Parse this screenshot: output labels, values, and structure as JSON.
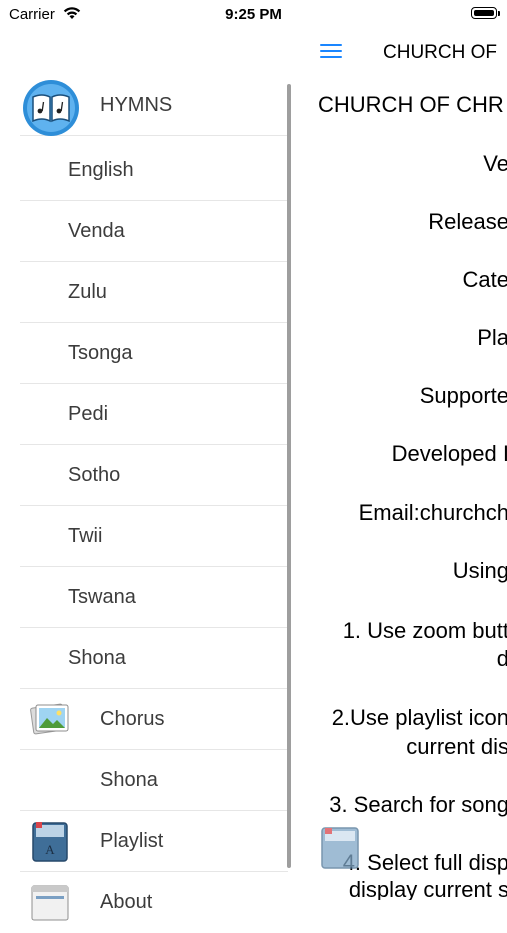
{
  "status": {
    "carrier": "Carrier",
    "time": "9:25 PM"
  },
  "navbar": {
    "title": "CHURCH OF"
  },
  "content": {
    "lines": [
      "CHURCH OF CHR",
      "Ve",
      "Release",
      "Cate",
      "Pla",
      "Supporte",
      "Developed I",
      "Email:churchch",
      "Using",
      "1. Use zoom butt",
      "d",
      "2.Use playlist icon",
      "current dis",
      "3. Search for song",
      "4. Select full disp",
      "display current s"
    ]
  },
  "drawer": {
    "header": "HYMNS",
    "languages": [
      "English",
      "Venda",
      "Zulu",
      "Tsonga",
      "Pedi",
      "Sotho",
      "Twii",
      "Tswana",
      "Shona"
    ],
    "chorus": "Chorus",
    "chorus_sub": "Shona",
    "playlist": "Playlist",
    "about": "About"
  },
  "colors": {
    "accent": "#1a86ff",
    "row_text": "#3c3c3c",
    "divider": "#e6e6e6"
  }
}
